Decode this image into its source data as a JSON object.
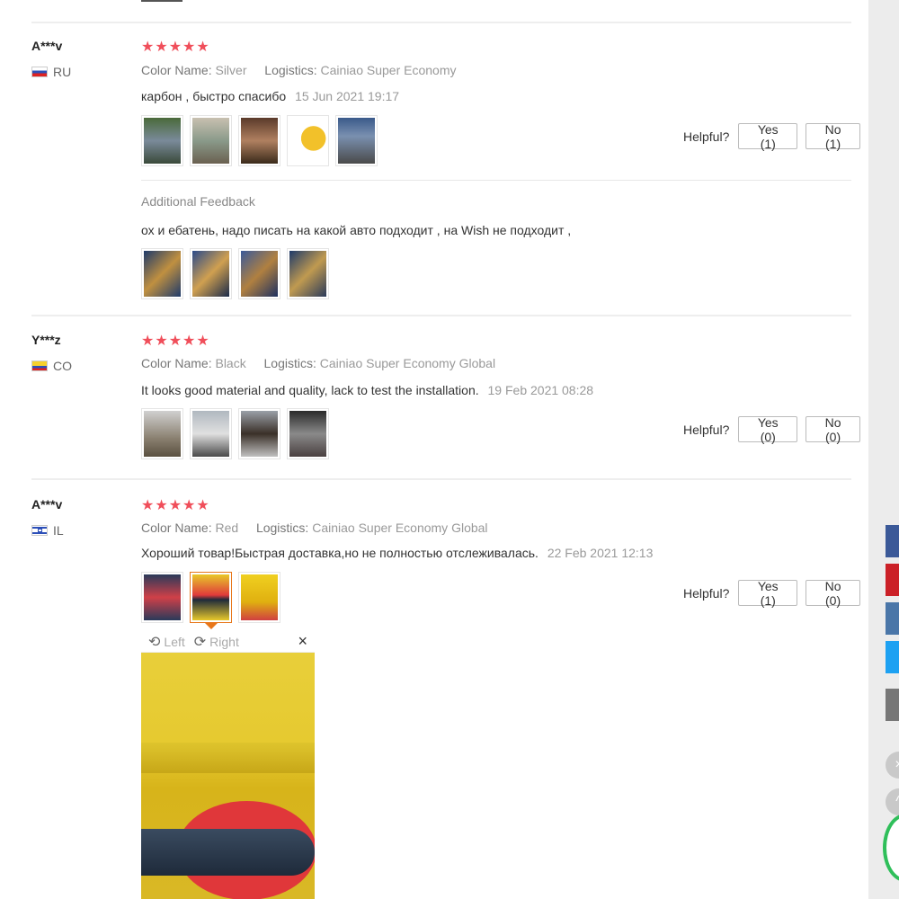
{
  "colors": {
    "star": "#f04e5a",
    "active_thumb_border": "#e8771a"
  },
  "labels": {
    "color_name": "Color Name:",
    "logistics": "Logistics:",
    "helpful": "Helpful?",
    "additional_feedback": "Additional Feedback"
  },
  "reviews": [
    {
      "user": "A***v",
      "country": "RU",
      "stars": "★★★★★",
      "color": "Silver",
      "logistics": "Cainiao Super Economy",
      "text": "карбон , быстро спасибо",
      "date": "15 Jun 2021 19:17",
      "yes": "Yes (1)",
      "no": "No (1)",
      "additional_text": "ох и ебатень, надо писать на какой авто подходит , на Wish не подходит ,"
    },
    {
      "user": "Y***z",
      "country": "CO",
      "stars": "★★★★★",
      "color": "Black",
      "logistics": "Cainiao Super Economy Global",
      "text": "It looks good material and quality, lack to test the installation.",
      "date": "19 Feb 2021 08:28",
      "yes": "Yes (0)",
      "no": "No (0)"
    },
    {
      "user": "A***v",
      "country": "IL",
      "stars": "★★★★★",
      "color": "Red",
      "logistics": "Cainiao Super Economy Global",
      "text": "Хороший товар!Быстрая доставка,но не полностью отслеживалась.",
      "date": "22 Feb 2021 12:13",
      "yes": "Yes (1)",
      "no": "No (0)"
    }
  ],
  "viewer": {
    "left": "Left",
    "right": "Right",
    "close": "×"
  },
  "icons": {
    "rotate_left": "rotate-left-icon",
    "rotate_right": "rotate-right-icon",
    "close": "close-icon"
  }
}
